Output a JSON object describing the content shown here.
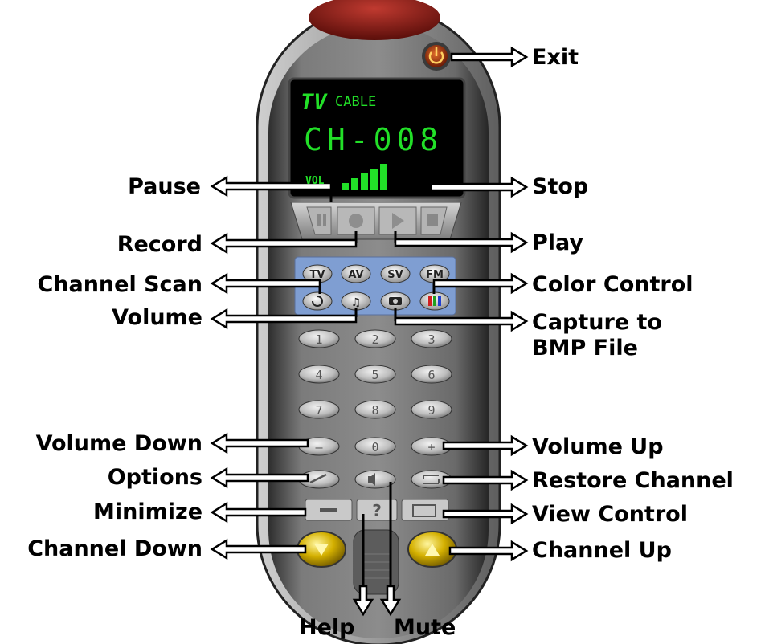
{
  "display": {
    "mode_tv": "TV",
    "mode_cable": "CABLE",
    "channel": "CH-008",
    "volume_label": "VOL",
    "volume_level_bars": 5,
    "volume_level_max": 5
  },
  "source_buttons": [
    "TV",
    "AV",
    "SV",
    "FM"
  ],
  "keypad": [
    "1",
    "2",
    "3",
    "4",
    "5",
    "6",
    "7",
    "8",
    "9",
    "–",
    "0",
    "+"
  ],
  "help_key": "?",
  "annotations": {
    "exit": "Exit",
    "pause": "Pause",
    "stop": "Stop",
    "record": "Record",
    "play": "Play",
    "channel_scan": "Channel Scan",
    "color_control": "Color Control",
    "volume": "Volume",
    "capture_line1": "Capture to",
    "capture_line2": "BMP File",
    "volume_down": "Volume Down",
    "volume_up": "Volume Up",
    "options": "Options",
    "restore_channel": "Restore Channel",
    "minimize": "Minimize",
    "view_control": "View Control",
    "channel_down": "Channel Down",
    "channel_up": "Channel Up",
    "help": "Help",
    "mute": "Mute"
  },
  "colors": {
    "body": "#6e6e6e",
    "lcd_text": "#22e028",
    "source_panel": "#7f9ed2",
    "power": "#b03a12",
    "channel_button": "#c9a800"
  }
}
